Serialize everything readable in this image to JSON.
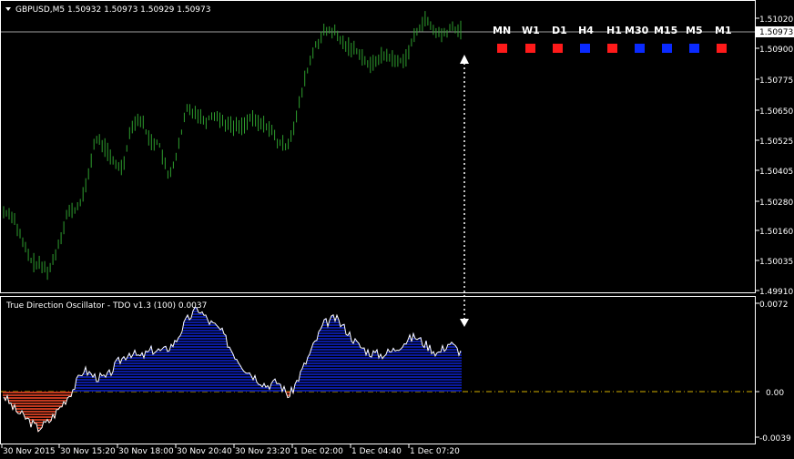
{
  "header": {
    "symbol_info": "GBPUSD,M5  1.50932 1.50973 1.50929 1.50973",
    "menu_icon": "triangle-down-icon"
  },
  "price_axis": {
    "labels": [
      "1.51020",
      "1.50900",
      "1.50775",
      "1.50650",
      "1.50525",
      "1.50405",
      "1.50280",
      "1.50160",
      "1.50035",
      "1.49910"
    ],
    "current_price": "1.50973"
  },
  "timeframe_panel": {
    "labels": [
      "MN",
      "W1",
      "D1",
      "H4",
      "H1",
      "M30",
      "M15",
      "M5",
      "M1"
    ],
    "signals": [
      "red",
      "red",
      "red",
      "blue",
      "red",
      "blue",
      "blue",
      "blue",
      "red"
    ]
  },
  "indicator": {
    "title": "True Direction Oscillator - TDO v1.3 (100) 0.0037",
    "axis_labels": [
      "0.0072",
      "0.00",
      "-0.0039"
    ]
  },
  "time_axis": {
    "labels": [
      "30 Nov 2015",
      "30 Nov 15:20",
      "30 Nov 18:00",
      "30 Nov 20:40",
      "30 Nov 23:20",
      "1 Dec 02:00",
      "1 Dec 04:40",
      "1 Dec 07:20"
    ]
  },
  "colors": {
    "background": "#000000",
    "candles": "#2e9e2e",
    "bull_histogram": "#0a1a9c",
    "bear_histogram": "#c0391f",
    "zero_line": "#d4b000",
    "signal_red": "#ff1a1a",
    "signal_blue": "#0a2aff",
    "frame": "#ffffff"
  },
  "chart_data": {
    "type": "line",
    "price_series": [
      1.5023,
      1.5022,
      1.5011,
      1.5003,
      1.5001,
      1.4999,
      1.501,
      1.5023,
      1.5024,
      1.5033,
      1.5053,
      1.505,
      1.5043,
      1.5041,
      1.5059,
      1.5061,
      1.5052,
      1.5051,
      1.5037,
      1.5047,
      1.5065,
      1.5064,
      1.506,
      1.5063,
      1.506,
      1.5058,
      1.5058,
      1.5061,
      1.5059,
      1.5058,
      1.5051,
      1.505,
      1.5061,
      1.5078,
      1.509,
      1.5096,
      1.5097,
      1.5092,
      1.509,
      1.5088,
      1.5082,
      1.5086,
      1.5087,
      1.5084,
      1.5086,
      1.5095,
      1.5102,
      1.5097,
      1.5095,
      1.5098,
      1.5097
    ],
    "oscillator_series": [
      -0.0003,
      -0.0015,
      -0.0022,
      -0.003,
      -0.0024,
      -0.0012,
      0.0001,
      0.0018,
      0.0012,
      0.0011,
      0.0024,
      0.0032,
      0.0028,
      0.0034,
      0.0033,
      0.004,
      0.0058,
      0.0068,
      0.0057,
      0.005,
      0.0033,
      0.002,
      0.0012,
      0.0005,
      0.0008,
      -0.0004,
      0.0015,
      0.0035,
      0.0055,
      0.006,
      0.005,
      0.0038,
      0.0032,
      0.003,
      0.0033,
      0.004,
      0.0045,
      0.0038,
      0.0031,
      0.004,
      0.0032
    ],
    "oscillator_range": [
      -0.0039,
      0.0072
    ]
  }
}
